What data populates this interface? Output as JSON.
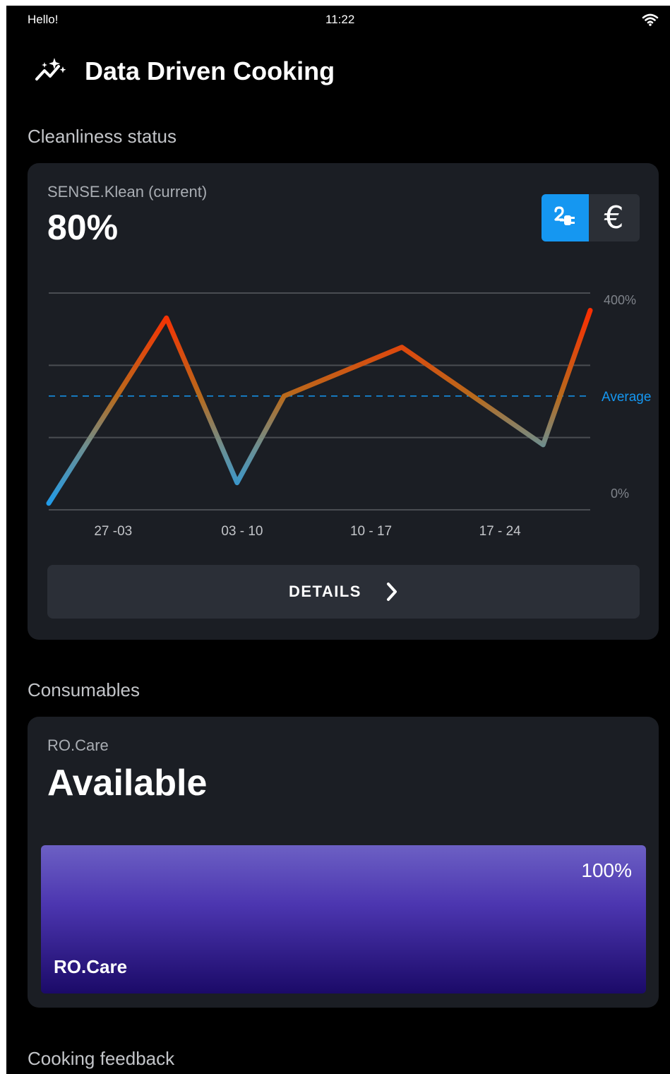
{
  "status_bar": {
    "left_text": "Hello!",
    "time": "11:22",
    "wifi_icon": "wifi-icon"
  },
  "header": {
    "title": "Data Driven Cooking",
    "icon": "trend-sparkle-icon"
  },
  "cleanliness": {
    "section_title": "Cleanliness status",
    "label": "SENSE.Klean (current)",
    "value": "80%",
    "toggle": {
      "active": "energy",
      "options": [
        "energy-icon",
        "euro-icon"
      ],
      "euro_symbol": "€"
    },
    "details_label": "DETAILS"
  },
  "chart_data": {
    "type": "line",
    "title": "",
    "xlabel": "",
    "ylabel": "",
    "ylim": [
      0,
      400
    ],
    "ytick_labels": [
      "400%",
      "0%"
    ],
    "x_labels": [
      "27  -03",
      "03 - 10",
      "10 - 17",
      "17 - 24"
    ],
    "grid": true,
    "x": [
      0,
      1.0,
      1.6,
      2.0,
      3.0,
      4.2,
      4.6
    ],
    "values": [
      12,
      354,
      50,
      210,
      300,
      120,
      368
    ],
    "average": 210,
    "average_label": "Average",
    "colors": {
      "low": "#1a9cf0",
      "mid": "#b86a1c",
      "high": "#ff2a00",
      "average_line": "#1597f1",
      "grid": "#4a4d52"
    }
  },
  "consumables": {
    "section_title": "Consumables",
    "label": "RO.Care",
    "value": "Available",
    "bar": {
      "name": "RO.Care",
      "percent_label": "100%",
      "fill_fraction": 1.0
    }
  },
  "cooking_feedback": {
    "section_title": "Cooking feedback"
  }
}
